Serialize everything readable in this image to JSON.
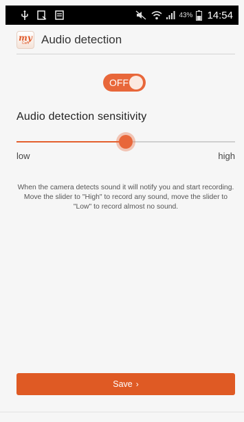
{
  "status_bar": {
    "battery_percent": "43%",
    "time": "14:54"
  },
  "header": {
    "logo_text": "my",
    "logo_subtext": "Cam",
    "title": "Audio detection"
  },
  "toggle": {
    "label": "OFF",
    "state": "off",
    "color": "#e8673a"
  },
  "sensitivity": {
    "title": "Audio detection sensitivity",
    "low_label": "low",
    "high_label": "high",
    "value_fraction": 0.5,
    "accent_color": "#e35f2c"
  },
  "description": "When the camera detects sound it will notify you and start recording. Move the slider to \"High\" to record any sound, move the slider to \"Low\" to record almost no sound.",
  "save_button": {
    "label": "Save",
    "chevron": "›",
    "color": "#df5a24"
  },
  "icons": {
    "status_left": [
      "usb-icon",
      "screenshot-icon",
      "notification-icon"
    ],
    "status_right": [
      "mute-icon",
      "wifi-icon",
      "signal-icon",
      "battery-icon"
    ]
  }
}
